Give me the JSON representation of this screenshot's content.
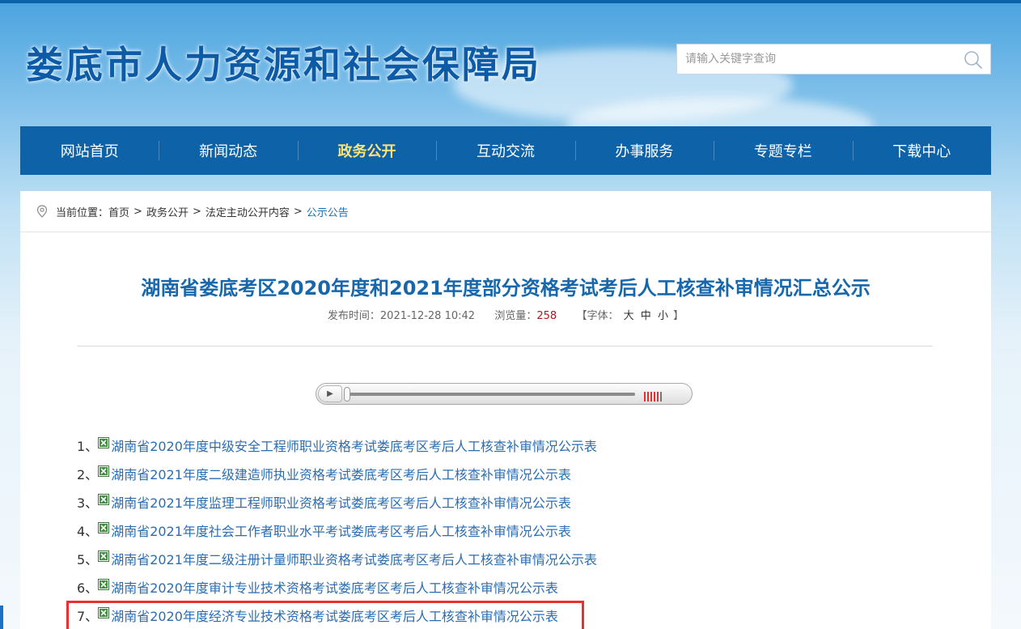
{
  "site": {
    "title": "娄底市人力资源和社会保障局"
  },
  "search": {
    "placeholder": "请输入关键字查询",
    "icon": "search-icon"
  },
  "nav": {
    "items": [
      {
        "label": "网站首页",
        "active": false
      },
      {
        "label": "新闻动态",
        "active": false
      },
      {
        "label": "政务公开",
        "active": true
      },
      {
        "label": "互动交流",
        "active": false
      },
      {
        "label": "办事服务",
        "active": false
      },
      {
        "label": "专题专栏",
        "active": false
      },
      {
        "label": "下载中心",
        "active": false
      }
    ]
  },
  "breadcrumb": {
    "prefix": "当前位置：",
    "icon": "location-pin-icon",
    "separator": ">",
    "items": [
      "首页",
      "政务公开",
      "法定主动公开内容",
      "公示公告"
    ]
  },
  "article": {
    "title": "湖南省娄底考区2020年度和2021年度部分资格考试考后人工核查补审情况汇总公示",
    "meta": {
      "publish_label": "发布时间：",
      "publish_time": "2021-12-28 10:42",
      "views_label": "浏览量：",
      "views": "258",
      "font_open": "【字体：",
      "font_large": "大",
      "font_medium": "中",
      "font_small": "小",
      "font_close": "】"
    }
  },
  "player": {
    "play_icon": "play-icon",
    "progress": 0,
    "volume_icon": "volume-icon"
  },
  "files": [
    {
      "num": "1、",
      "name": "湖南省2020年度中级安全工程师职业资格考试娄底考区考后人工核查补审情况公示表"
    },
    {
      "num": "2、",
      "name": "湖南省2021年度二级建造师执业资格考试娄底考区考后人工核查补审情况公示表"
    },
    {
      "num": "3、",
      "name": "湖南省2021年度监理工程师职业资格考试娄底考区考后人工核查补审情况公示表"
    },
    {
      "num": "4、",
      "name": "湖南省2021年度社会工作者职业水平考试娄底考区考后人工核查补审情况公示表"
    },
    {
      "num": "5、",
      "name": "湖南省2021年度二级注册计量师职业资格考试娄底考区考后人工核查补审情况公示表"
    },
    {
      "num": "6、",
      "name": "湖南省2020年度审计专业技术资格考试娄底考区考后人工核查补审情况公示表"
    },
    {
      "num": "7、",
      "name": "湖南省2020年度经济专业技术资格考试娄底考区考后人工核查补审情况公示表"
    }
  ],
  "highlighted_file_index": 6,
  "colors": {
    "brand": "#0d62a8",
    "nav_active": "#ffe27a",
    "title": "#1767ad",
    "link": "#2a6db3",
    "views": "#b3161b",
    "highlight": "#ef2f2f"
  }
}
